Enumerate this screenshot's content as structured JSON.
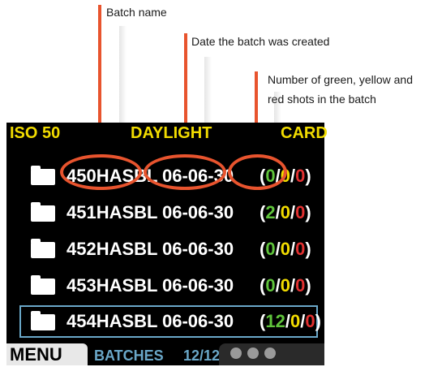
{
  "annotations": {
    "batch_name": "Batch name",
    "date_created": "Date the batch was created",
    "counts_line1": "Number of green, yellow and",
    "counts_line2": "red shots in the batch"
  },
  "status_bar": {
    "iso": "ISO 50",
    "white_balance": "DAYLIGHT",
    "storage": "CARD"
  },
  "batches": [
    {
      "name": "450HASBL",
      "date": "06-06-30",
      "open": "(",
      "green": "0",
      "yellow": "0",
      "red": "0",
      "close": ")"
    },
    {
      "name": "451HASBL",
      "date": "06-06-30",
      "open": "(",
      "green": "2",
      "yellow": "0",
      "red": "0",
      "close": ")"
    },
    {
      "name": "452HASBL",
      "date": "06-06-30",
      "open": "(",
      "green": "0",
      "yellow": "0",
      "red": "0",
      "close": ")"
    },
    {
      "name": "453HASBL",
      "date": "06-06-30",
      "open": "(",
      "green": "0",
      "yellow": "0",
      "red": "0",
      "close": ")"
    },
    {
      "name": "454HASBL",
      "date": "06-06-30",
      "open": "(",
      "green": "12",
      "yellow": "0",
      "red": "0",
      "close": ")"
    }
  ],
  "separator": "/",
  "selected_index": 4,
  "bottom_bar": {
    "menu": "MENU",
    "section": "BATCHES",
    "position": "12/12"
  },
  "colors": {
    "accent": "#e8542e",
    "selection": "#6aa7c8",
    "green": "#5fc43b",
    "yellow": "#f2dc00",
    "red": "#e23030"
  },
  "icons": [
    "folder-icon",
    "camera-icon"
  ]
}
